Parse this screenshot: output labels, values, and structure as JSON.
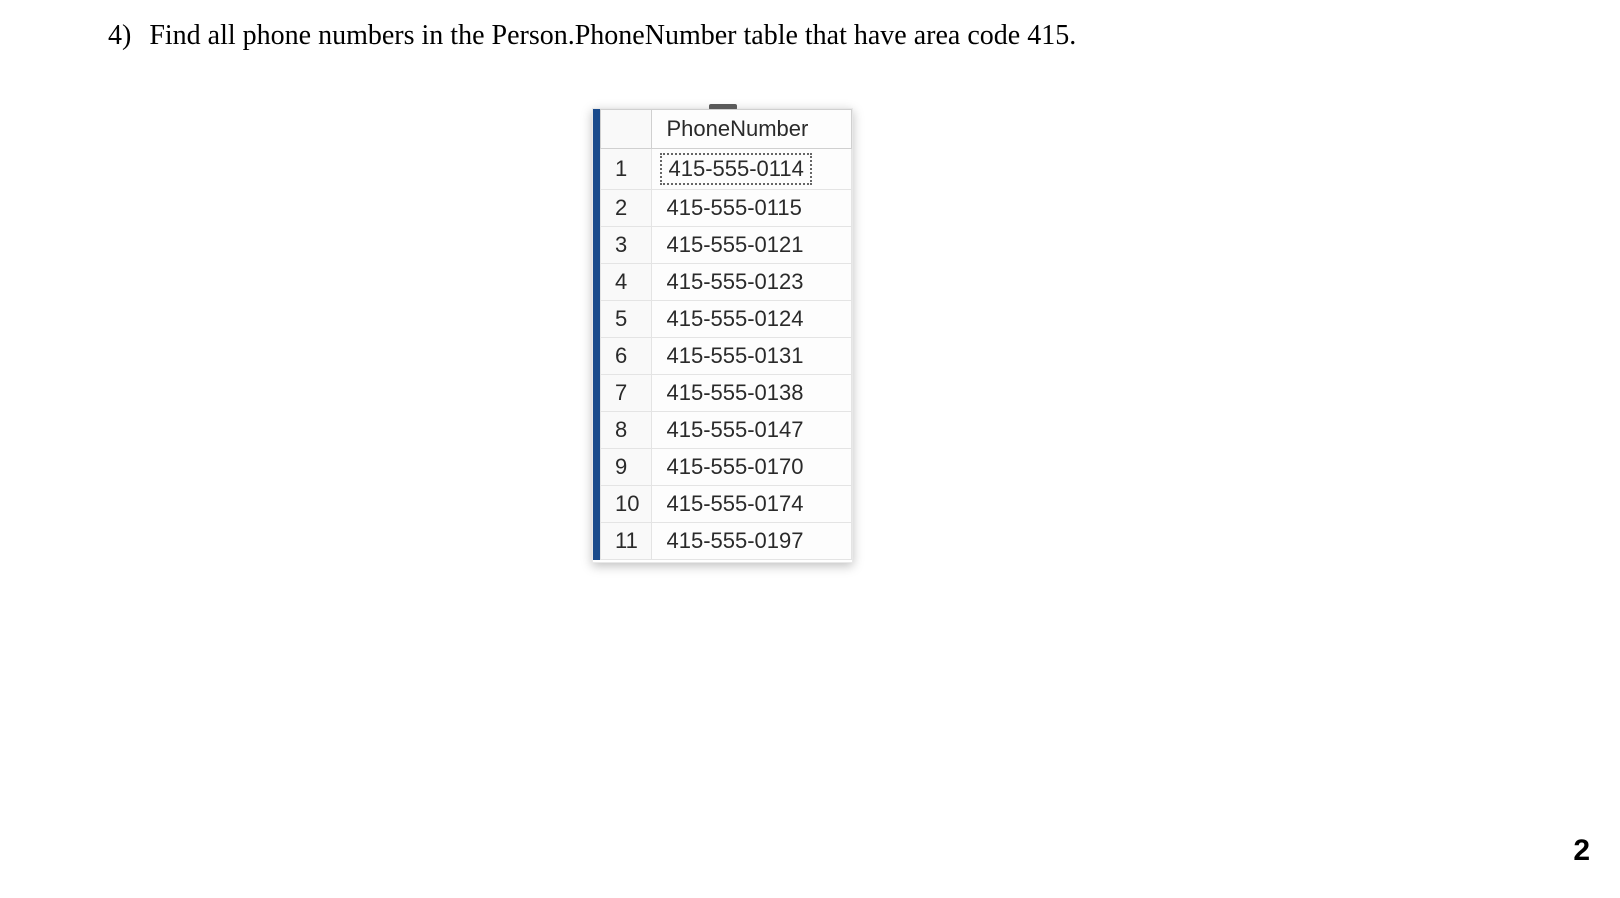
{
  "question": {
    "number": "4)",
    "text": "Find all phone numbers in the Person.PhoneNumber table that have area code 415."
  },
  "grid": {
    "column_header": "PhoneNumber",
    "rows": [
      {
        "n": "1",
        "phone": "415-555-0114"
      },
      {
        "n": "2",
        "phone": "415-555-0115"
      },
      {
        "n": "3",
        "phone": "415-555-0121"
      },
      {
        "n": "4",
        "phone": "415-555-0123"
      },
      {
        "n": "5",
        "phone": "415-555-0124"
      },
      {
        "n": "6",
        "phone": "415-555-0131"
      },
      {
        "n": "7",
        "phone": "415-555-0138"
      },
      {
        "n": "8",
        "phone": "415-555-0147"
      },
      {
        "n": "9",
        "phone": "415-555-0170"
      },
      {
        "n": "10",
        "phone": "415-555-0174"
      },
      {
        "n": "11",
        "phone": "415-555-0197"
      }
    ]
  },
  "page_number": "2"
}
